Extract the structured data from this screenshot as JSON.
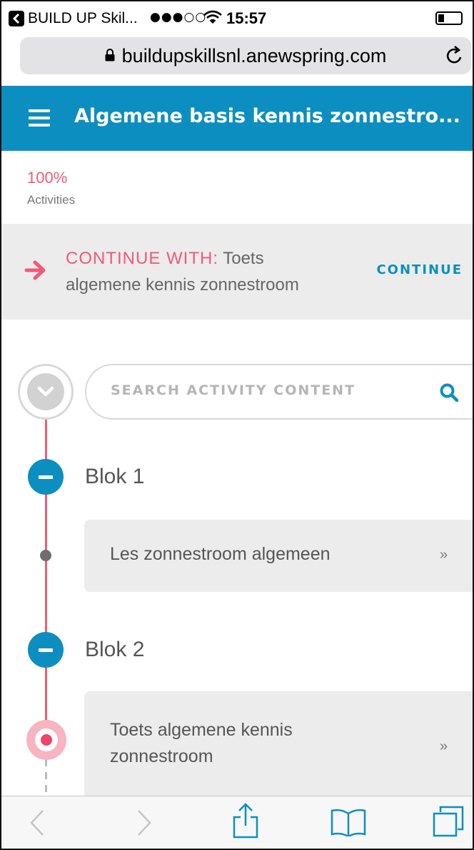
{
  "status_bar": {
    "back_app": "BUILD UP Skil...",
    "signal": "●●●○○",
    "time": "15:57"
  },
  "browser": {
    "url": "buildupskillsnl.anewspring.com"
  },
  "header": {
    "title": "Algemene basis kennis zonnestro..."
  },
  "progress": {
    "percent": "100%",
    "label": "Activities",
    "value": 1.0
  },
  "continue_banner": {
    "prefix": "CONTINUE WITH:",
    "activity": "Toets algemene kennis zonnestroom",
    "button": "CONTINUE"
  },
  "search": {
    "placeholder": "SEARCH ACTIVITY CONTENT"
  },
  "blocks": [
    {
      "title": "Blok 1",
      "activities": [
        {
          "label": "Les zonnestroom algemeen",
          "chevron": "»"
        }
      ]
    },
    {
      "title": "Blok 2",
      "activities": [
        {
          "label": "Toets algemene kennis zonnestroom",
          "chevron": "»"
        }
      ]
    }
  ],
  "colors": {
    "brand_blue": "#0c8fc0",
    "accent_pink": "#f05a78",
    "timeline": "#ee5c79"
  },
  "icons": [
    "back-app-icon",
    "wifi-icon",
    "battery-icon",
    "lock-icon",
    "reload-icon",
    "menu-icon",
    "arrow-right-icon",
    "chevron-down-icon",
    "search-icon",
    "minus-icon",
    "back-icon",
    "forward-icon",
    "share-icon",
    "bookmarks-icon",
    "tabs-icon"
  ]
}
